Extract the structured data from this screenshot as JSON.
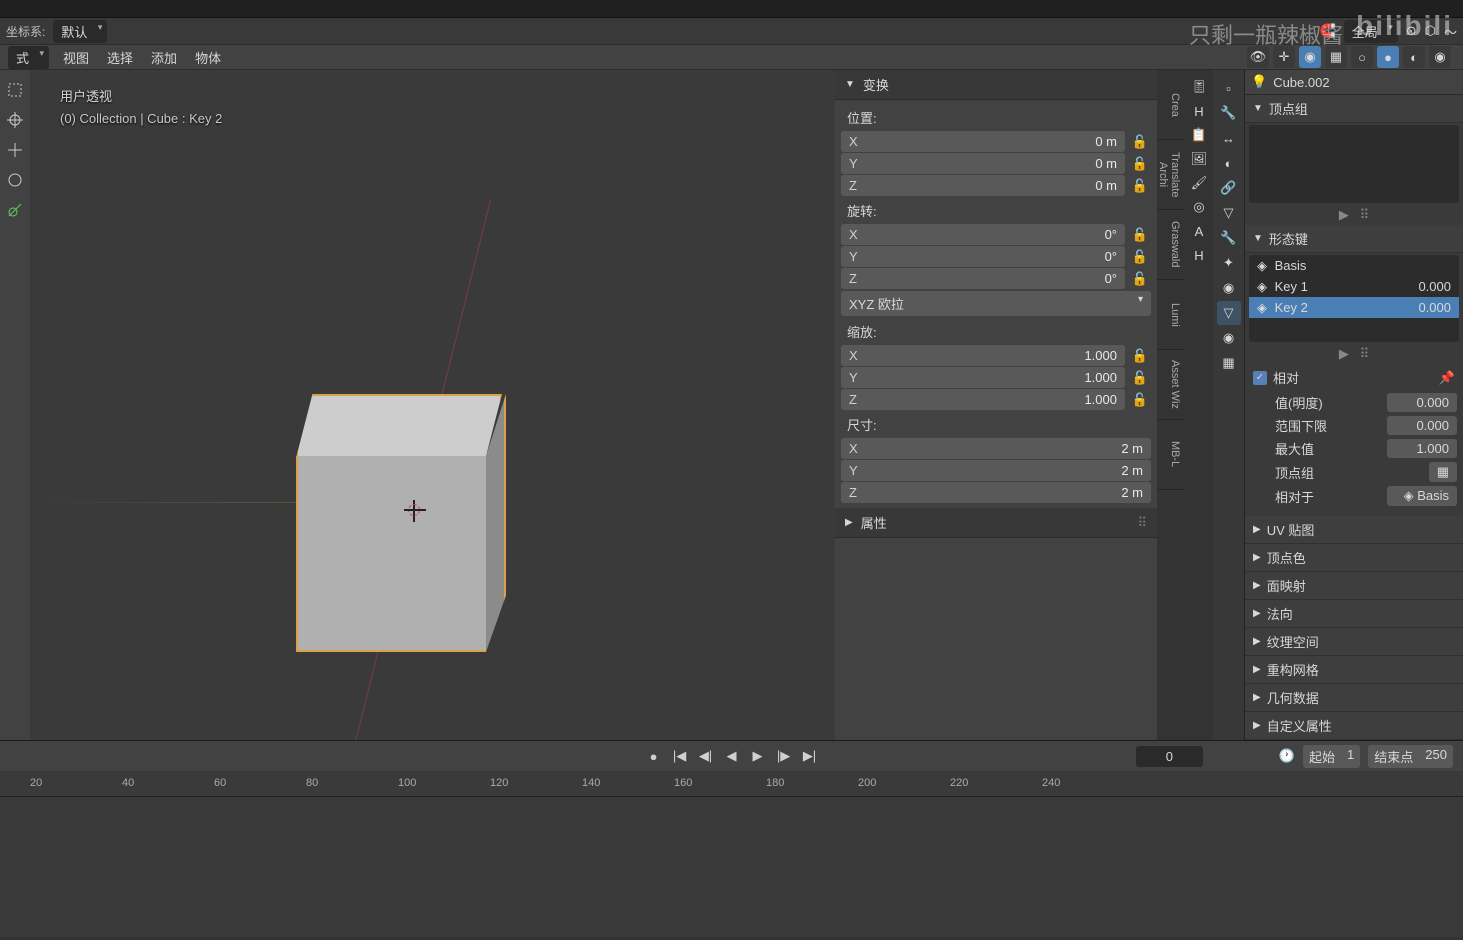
{
  "header": {
    "coord_label": "坐标系:",
    "coord_value": "默认",
    "orient": "全局"
  },
  "menu": {
    "mode": "式",
    "view": "视图",
    "select": "选择",
    "add": "添加",
    "object": "物体"
  },
  "viewport": {
    "persp": "用户透视",
    "context": "(0) Collection | Cube : Key 2"
  },
  "npanel": {
    "transform": "变换",
    "position": "位置:",
    "rotation": "旋转:",
    "scale": "缩放:",
    "dimensions": "尺寸:",
    "props": "属性",
    "rot_mode": "XYZ 欧拉",
    "pos": {
      "x": "0 m",
      "y": "0 m",
      "z": "0 m"
    },
    "rot": {
      "x": "0°",
      "y": "0°",
      "z": "0°"
    },
    "scl": {
      "x": "1.000",
      "y": "1.000",
      "z": "1.000"
    },
    "dim": {
      "x": "2 m",
      "y": "2 m",
      "z": "2 m"
    }
  },
  "vtabs": {
    "t1": "Crea",
    "t2": "Translate Archi",
    "t3": "Graswald",
    "t4": "Lumi",
    "t5": "Asset Wiz",
    "t6": "MB-L"
  },
  "right": {
    "obj": "Cube.002",
    "vg": "顶点组",
    "sk": "形态键",
    "basis": "Basis",
    "k1": "Key 1",
    "k1v": "0.000",
    "k2": "Key 2",
    "k2v": "0.000",
    "rel": "相对",
    "value": "值(明度)",
    "value_v": "0.000",
    "min": "范围下限",
    "min_v": "0.000",
    "max": "最大值",
    "max_v": "1.000",
    "vgroup": "顶点组",
    "relto": "相对于",
    "relto_v": "Basis",
    "uv": "UV 贴图",
    "vcol": "顶点色",
    "fmap": "面映射",
    "normal": "法向",
    "texspace": "纹理空间",
    "remesh": "重构网格",
    "geom": "几何数据",
    "custom": "自定义属性"
  },
  "timeline": {
    "frame": "0",
    "start_l": "起始",
    "start_v": "1",
    "end_l": "结束点",
    "end_v": "250",
    "ticks": [
      "20",
      "40",
      "60",
      "80",
      "100",
      "120",
      "140",
      "160",
      "180",
      "200",
      "220",
      "240"
    ]
  },
  "watermark": "bilibili",
  "watermark2": "只剩一瓶辣椒酱"
}
